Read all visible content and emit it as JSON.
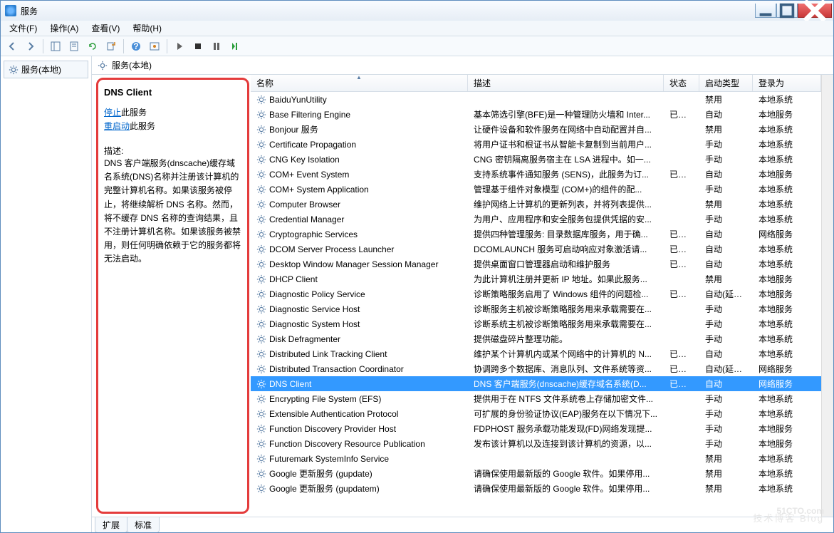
{
  "window": {
    "title": "服务"
  },
  "menu": {
    "file": "文件(F)",
    "action": "操作(A)",
    "view": "查看(V)",
    "help": "帮助(H)"
  },
  "left": {
    "node": "服务(本地)"
  },
  "right_header": "服务(本地)",
  "detail": {
    "title": "DNS Client",
    "stop_link": "停止",
    "stop_suffix": "此服务",
    "restart_link": "重启动",
    "restart_suffix": "此服务",
    "desc_label": "描述:",
    "desc_text": "DNS 客户端服务(dnscache)缓存域名系统(DNS)名称并注册该计算机的完整计算机名称。如果该服务被停止，将继续解析 DNS 名称。然而，将不缓存 DNS 名称的查询结果，且不注册计算机名称。如果该服务被禁用，则任何明确依赖于它的服务都将无法启动。"
  },
  "columns": {
    "name": "名称",
    "desc": "描述",
    "status": "状态",
    "startup": "启动类型",
    "logon": "登录为"
  },
  "tabs": {
    "extended": "扩展",
    "standard": "标准"
  },
  "watermark": {
    "main": "51CTO.com",
    "sub": "技术博客  Blog"
  },
  "services": [
    {
      "name": "BaiduYunUtility",
      "desc": "",
      "status": "",
      "startup": "禁用",
      "logon": "本地系统"
    },
    {
      "name": "Base Filtering Engine",
      "desc": "基本筛选引擎(BFE)是一种管理防火墙和 Inter...",
      "status": "已启动",
      "startup": "自动",
      "logon": "本地服务"
    },
    {
      "name": "Bonjour 服务",
      "desc": "让硬件设备和软件服务在网络中自动配置并自...",
      "status": "",
      "startup": "禁用",
      "logon": "本地系统"
    },
    {
      "name": "Certificate Propagation",
      "desc": "将用户证书和根证书从智能卡复制到当前用户...",
      "status": "",
      "startup": "手动",
      "logon": "本地系统"
    },
    {
      "name": "CNG Key Isolation",
      "desc": "CNG 密钥隔离服务宿主在 LSA 进程中。如一...",
      "status": "",
      "startup": "手动",
      "logon": "本地系统"
    },
    {
      "name": "COM+ Event System",
      "desc": "支持系统事件通知服务 (SENS)，此服务为订...",
      "status": "已启动",
      "startup": "自动",
      "logon": "本地服务"
    },
    {
      "name": "COM+ System Application",
      "desc": "管理基于组件对象模型 (COM+)的组件的配...",
      "status": "",
      "startup": "手动",
      "logon": "本地系统"
    },
    {
      "name": "Computer Browser",
      "desc": "维护网络上计算机的更新列表，并将列表提供...",
      "status": "",
      "startup": "禁用",
      "logon": "本地系统"
    },
    {
      "name": "Credential Manager",
      "desc": "为用户、应用程序和安全服务包提供凭据的安...",
      "status": "",
      "startup": "手动",
      "logon": "本地系统"
    },
    {
      "name": "Cryptographic Services",
      "desc": "提供四种管理服务: 目录数据库服务，用于确...",
      "status": "已启动",
      "startup": "自动",
      "logon": "网络服务"
    },
    {
      "name": "DCOM Server Process Launcher",
      "desc": "DCOMLAUNCH 服务可启动响应对象激活请...",
      "status": "已启动",
      "startup": "自动",
      "logon": "本地系统"
    },
    {
      "name": "Desktop Window Manager Session Manager",
      "desc": "提供桌面窗口管理器启动和维护服务",
      "status": "已启动",
      "startup": "自动",
      "logon": "本地系统"
    },
    {
      "name": "DHCP Client",
      "desc": "为此计算机注册并更新 IP 地址。如果此服务...",
      "status": "",
      "startup": "禁用",
      "logon": "本地服务"
    },
    {
      "name": "Diagnostic Policy Service",
      "desc": "诊断策略服务启用了 Windows 组件的问题检...",
      "status": "已启动",
      "startup": "自动(延迟...",
      "logon": "本地服务"
    },
    {
      "name": "Diagnostic Service Host",
      "desc": "诊断服务主机被诊断策略服务用来承载需要在...",
      "status": "",
      "startup": "手动",
      "logon": "本地服务"
    },
    {
      "name": "Diagnostic System Host",
      "desc": "诊断系统主机被诊断策略服务用来承载需要在...",
      "status": "",
      "startup": "手动",
      "logon": "本地系统"
    },
    {
      "name": "Disk Defragmenter",
      "desc": "提供磁盘碎片整理功能。",
      "status": "",
      "startup": "手动",
      "logon": "本地系统"
    },
    {
      "name": "Distributed Link Tracking Client",
      "desc": "维护某个计算机内或某个网络中的计算机的 N...",
      "status": "已启动",
      "startup": "自动",
      "logon": "本地系统"
    },
    {
      "name": "Distributed Transaction Coordinator",
      "desc": "协调跨多个数据库、消息队列、文件系统等资...",
      "status": "已启动",
      "startup": "自动(延迟...",
      "logon": "网络服务"
    },
    {
      "name": "DNS Client",
      "desc": "DNS 客户端服务(dnscache)缓存域名系统(D...",
      "status": "已启动",
      "startup": "自动",
      "logon": "网络服务",
      "selected": true
    },
    {
      "name": "Encrypting File System (EFS)",
      "desc": "提供用于在 NTFS 文件系统卷上存储加密文件...",
      "status": "",
      "startup": "手动",
      "logon": "本地系统"
    },
    {
      "name": "Extensible Authentication Protocol",
      "desc": "可扩展的身份验证协议(EAP)服务在以下情况下...",
      "status": "",
      "startup": "手动",
      "logon": "本地系统"
    },
    {
      "name": "Function Discovery Provider Host",
      "desc": "FDPHOST 服务承载功能发现(FD)网络发现提...",
      "status": "",
      "startup": "手动",
      "logon": "本地服务"
    },
    {
      "name": "Function Discovery Resource Publication",
      "desc": "发布该计算机以及连接到该计算机的资源，以...",
      "status": "",
      "startup": "手动",
      "logon": "本地服务"
    },
    {
      "name": "Futuremark SystemInfo Service",
      "desc": "",
      "status": "",
      "startup": "禁用",
      "logon": "本地系统"
    },
    {
      "name": "Google 更新服务 (gupdate)",
      "desc": "请确保使用最新版的 Google 软件。如果停用...",
      "status": "",
      "startup": "禁用",
      "logon": "本地系统"
    },
    {
      "name": "Google 更新服务 (gupdatem)",
      "desc": "请确保使用最新版的 Google 软件。如果停用...",
      "status": "",
      "startup": "禁用",
      "logon": "本地系统"
    }
  ]
}
